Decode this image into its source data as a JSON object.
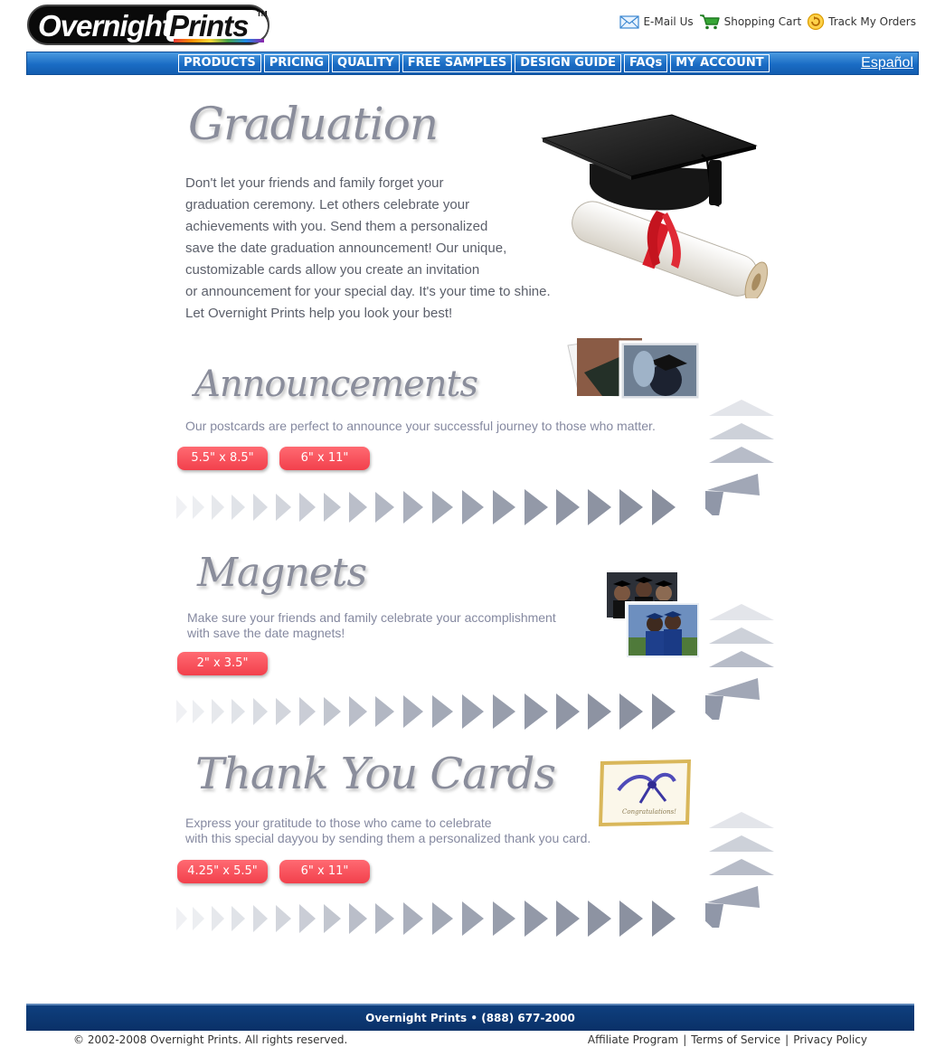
{
  "brand": {
    "name_part1": "Overnight",
    "name_part2": "Prints",
    "trademark": "TM"
  },
  "top_links": [
    {
      "label": "E-Mail Us",
      "icon": "envelope-icon"
    },
    {
      "label": "Shopping Cart",
      "icon": "shopping-cart-icon"
    },
    {
      "label": "Track My Orders",
      "icon": "track-orders-icon"
    }
  ],
  "nav": {
    "items": [
      "PRODUCTS",
      "PRICING",
      "QUALITY",
      "FREE SAMPLES",
      "DESIGN GUIDE",
      "FAQs",
      "MY ACCOUNT"
    ],
    "language_link": "Español"
  },
  "intro": {
    "title": "Graduation",
    "lines": [
      "Don't let your friends and family forget your",
      "graduation ceremony. Let others celebrate your",
      "achievements with you. Send them a personalized",
      "save the date graduation announcement! Our unique,",
      "customizable cards allow you create an invitation",
      "or announcement for your special day. It's your time to shine.",
      "Let Overnight Prints help you look your best!"
    ]
  },
  "sections": [
    {
      "title": "Announcements",
      "lines": [
        "Our postcards are perfect to announce your successful journey to those who matter."
      ],
      "sizes": [
        "5.5\" x 8.5\"",
        "6\" x 11\""
      ]
    },
    {
      "title": "Magnets",
      "lines": [
        "Make sure your friends and family celebrate your accomplishment",
        "with save the date magnets!"
      ],
      "sizes": [
        "2\" x 3.5\""
      ]
    },
    {
      "title": "Thank You Cards",
      "lines": [
        "Express your gratitude to those who came to celebrate",
        "with  this special dayyou by sending them a personalized thank you card."
      ],
      "sizes": [
        "4.25\" x 5.5\"",
        "6\" x 11\""
      ]
    }
  ],
  "thank_you_card_text": "Congratulations!",
  "colors": {
    "nav_blue": "#1a6cc4",
    "pill_red": "#f2404c",
    "footer_navy": "#0a3168"
  },
  "footer": {
    "contact": "Overnight Prints • (888) 677-2000",
    "copyright": "© 2002-2008 Overnight Prints. All rights reserved.",
    "links": [
      "Affiliate Program",
      "Terms of Service",
      "Privacy Policy"
    ],
    "separator": "|"
  }
}
